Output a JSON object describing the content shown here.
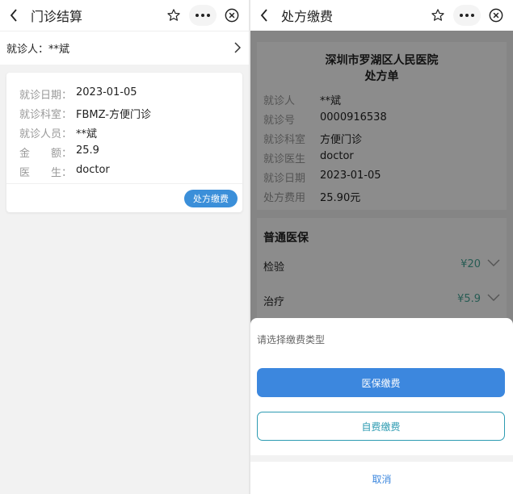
{
  "left": {
    "nav_title": "门诊结算",
    "patient_bar": "就诊人：**斌",
    "record": [
      {
        "label": "就诊日期：",
        "value": "2023-01-05"
      },
      {
        "label": "就诊科室：",
        "value": "FBMZ-方便门诊"
      },
      {
        "label": "就诊人员：",
        "value": "**斌"
      },
      {
        "label": "金　　额：",
        "value": "25.9"
      },
      {
        "label": "医　　生：",
        "value": "doctor"
      }
    ],
    "pay_button": "处方缴费"
  },
  "right": {
    "nav_title": "处方缴费",
    "hospital": "深圳市罗湖区人民医院",
    "doc_title": "处方单",
    "rx": [
      {
        "label": "就诊人",
        "value": "**斌"
      },
      {
        "label": "就诊号",
        "value": "0000916538"
      },
      {
        "label": "就诊科室",
        "value": "方便门诊"
      },
      {
        "label": "就诊医生",
        "value": "doctor"
      },
      {
        "label": "就诊日期",
        "value": "2023-01-05"
      },
      {
        "label": "处方费用",
        "value": "25.90元"
      }
    ],
    "insurance_title": "普通医保",
    "items": [
      {
        "name": "检验",
        "price": "¥20"
      },
      {
        "name": "治疗",
        "price": "¥5.9"
      }
    ],
    "sheet": {
      "title": "请选择缴费类型",
      "insurance_pay": "医保缴费",
      "self_pay": "自费缴费",
      "cancel": "取消"
    }
  },
  "colors": {
    "primary": "#3c87de",
    "teal": "#2d9bb2",
    "price": "#4aa89a"
  }
}
